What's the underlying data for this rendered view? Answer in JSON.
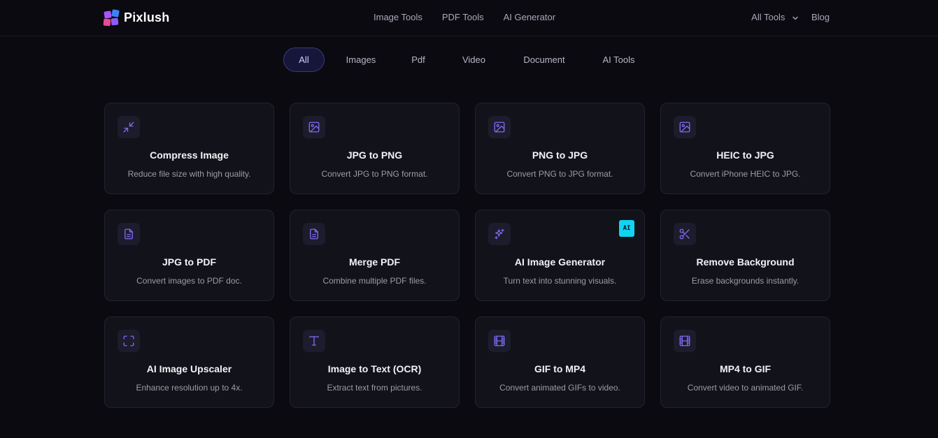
{
  "brand": {
    "name": "Pixlush",
    "colors": [
      "#a855f7",
      "#3b82f6",
      "#ec4899",
      "#8b5cf6"
    ]
  },
  "nav": {
    "center": [
      "Image Tools",
      "PDF Tools",
      "AI Generator"
    ],
    "all_tools": "All Tools",
    "blog": "Blog"
  },
  "tabs": [
    {
      "label": "All",
      "active": true
    },
    {
      "label": "Images",
      "active": false
    },
    {
      "label": "Pdf",
      "active": false
    },
    {
      "label": "Video",
      "active": false
    },
    {
      "label": "Document",
      "active": false
    },
    {
      "label": "AI Tools",
      "active": false
    }
  ],
  "accent": "#7c6cf0",
  "cards": [
    {
      "title": "Compress Image",
      "desc": "Reduce file size with high quality.",
      "icon": "compress-icon"
    },
    {
      "title": "JPG to PNG",
      "desc": "Convert JPG to PNG format.",
      "icon": "image-icon"
    },
    {
      "title": "PNG to JPG",
      "desc": "Convert PNG to JPG format.",
      "icon": "image-icon"
    },
    {
      "title": "HEIC to JPG",
      "desc": "Convert iPhone HEIC to JPG.",
      "icon": "image-icon"
    },
    {
      "title": "JPG to PDF",
      "desc": "Convert images to PDF doc.",
      "icon": "document-icon"
    },
    {
      "title": "Merge PDF",
      "desc": "Combine multiple PDF files.",
      "icon": "document-icon"
    },
    {
      "title": "AI Image Generator",
      "desc": "Turn text into stunning visuals.",
      "icon": "sparkles-icon",
      "badge": "AI"
    },
    {
      "title": "Remove Background",
      "desc": "Erase backgrounds instantly.",
      "icon": "scissors-icon"
    },
    {
      "title": "AI Image Upscaler",
      "desc": "Enhance resolution up to 4x.",
      "icon": "expand-frame-icon"
    },
    {
      "title": "Image to Text (OCR)",
      "desc": "Extract text from pictures.",
      "icon": "text-icon"
    },
    {
      "title": "GIF to MP4",
      "desc": "Convert animated GIFs to video.",
      "icon": "film-icon"
    },
    {
      "title": "MP4 to GIF",
      "desc": "Convert video to animated GIF.",
      "icon": "film-icon"
    }
  ]
}
